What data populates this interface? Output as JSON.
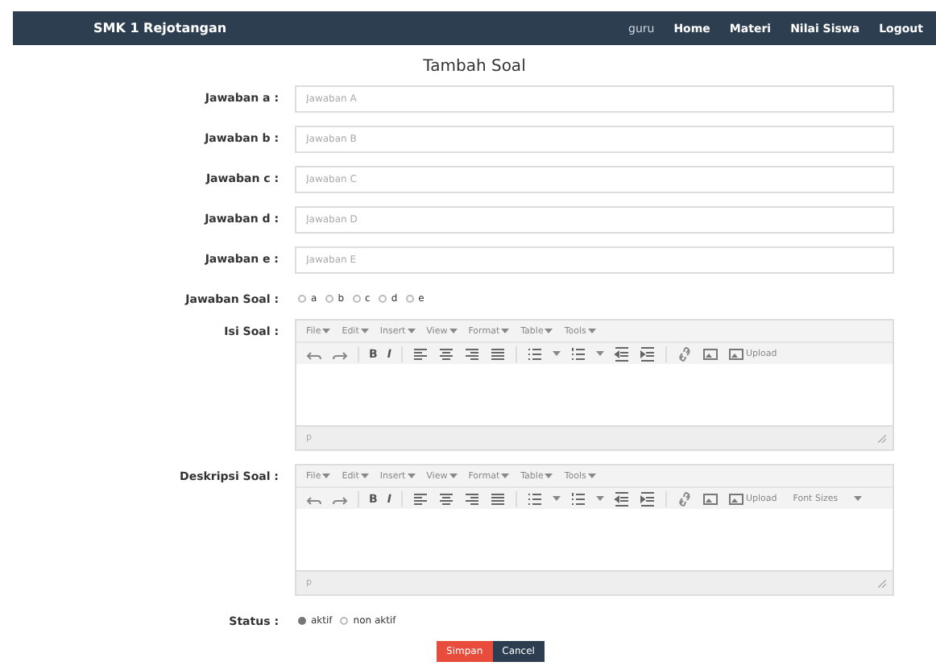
{
  "navbar": {
    "brand": "SMK 1 Rejotangan",
    "links": [
      {
        "label": "guru",
        "selected": true
      },
      {
        "label": "Home",
        "selected": false
      },
      {
        "label": "Materi",
        "selected": false
      },
      {
        "label": "Nilai Siswa",
        "selected": false
      },
      {
        "label": "Logout",
        "selected": false
      }
    ]
  },
  "title": "Tambah Soal",
  "fields": [
    {
      "label": "Jawaban a :",
      "placeholder": "Jawaban A"
    },
    {
      "label": "Jawaban b :",
      "placeholder": "Jawaban B"
    },
    {
      "label": "Jawaban c :",
      "placeholder": "Jawaban C"
    },
    {
      "label": "Jawaban d :",
      "placeholder": "Jawaban D"
    },
    {
      "label": "Jawaban e :",
      "placeholder": "Jawaban E"
    }
  ],
  "answer": {
    "label": "Jawaban Soal :",
    "options": [
      {
        "label": "a",
        "selected": false
      },
      {
        "label": "b",
        "selected": false
      },
      {
        "label": "c",
        "selected": false
      },
      {
        "label": "d",
        "selected": false
      },
      {
        "label": "e",
        "selected": false
      }
    ]
  },
  "editors": [
    {
      "label": "Isi Soal :",
      "menu": [
        "File",
        "Edit",
        "Insert",
        "View",
        "Format",
        "Table",
        "Tools"
      ],
      "bold": "B",
      "italic": "I",
      "upload": "Upload",
      "path": "p"
    },
    {
      "label": "Deskripsi Soal :",
      "menu": [
        "File",
        "Edit",
        "Insert",
        "View",
        "Format",
        "Table",
        "Tools"
      ],
      "bold": "B",
      "italic": "I",
      "upload": "Upload",
      "font_sizes": "Font Sizes",
      "path": "p"
    }
  ],
  "status": {
    "label": "Status :",
    "options": [
      {
        "label": "aktif",
        "selected": true
      },
      {
        "label": "non aktif",
        "selected": false
      }
    ]
  },
  "buttons": [
    {
      "label": "Simpan",
      "kind": "primary"
    },
    {
      "label": "Cancel",
      "kind": "secondary"
    }
  ]
}
